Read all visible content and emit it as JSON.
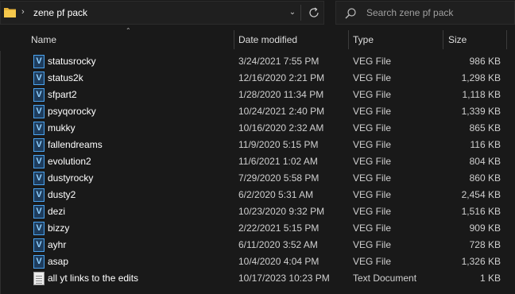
{
  "address_bar": {
    "path": "zene pf pack",
    "chevron": "›",
    "folder_icon": "folder-icon",
    "dropdown_icon": "chevron-down-icon",
    "refresh_icon": "refresh-icon"
  },
  "search": {
    "placeholder": "Search zene pf pack",
    "icon": "search-icon"
  },
  "columns": {
    "name": "Name",
    "date": "Date modified",
    "type": "Type",
    "size": "Size"
  },
  "files": [
    {
      "name": "statusrocky",
      "date": "3/24/2021 7:55 PM",
      "type": "VEG File",
      "size": "986 KB",
      "icon": "veg-file-icon"
    },
    {
      "name": "status2k",
      "date": "12/16/2020 2:21 PM",
      "type": "VEG File",
      "size": "1,298 KB",
      "icon": "veg-file-icon"
    },
    {
      "name": "sfpart2",
      "date": "1/28/2020 11:34 PM",
      "type": "VEG File",
      "size": "1,118 KB",
      "icon": "veg-file-icon"
    },
    {
      "name": "psyqorocky",
      "date": "10/24/2021 2:40 PM",
      "type": "VEG File",
      "size": "1,339 KB",
      "icon": "veg-file-icon"
    },
    {
      "name": "mukky",
      "date": "10/16/2020 2:32 AM",
      "type": "VEG File",
      "size": "865 KB",
      "icon": "veg-file-icon"
    },
    {
      "name": "fallendreams",
      "date": "11/9/2020 5:15 PM",
      "type": "VEG File",
      "size": "116 KB",
      "icon": "veg-file-icon"
    },
    {
      "name": "evolution2",
      "date": "11/6/2021 1:02 AM",
      "type": "VEG File",
      "size": "804 KB",
      "icon": "veg-file-icon"
    },
    {
      "name": "dustyrocky",
      "date": "7/29/2020 5:58 PM",
      "type": "VEG File",
      "size": "860 KB",
      "icon": "veg-file-icon"
    },
    {
      "name": "dusty2",
      "date": "6/2/2020 5:31 AM",
      "type": "VEG File",
      "size": "2,454 KB",
      "icon": "veg-file-icon"
    },
    {
      "name": "dezi",
      "date": "10/23/2020 9:32 PM",
      "type": "VEG File",
      "size": "1,516 KB",
      "icon": "veg-file-icon"
    },
    {
      "name": "bizzy",
      "date": "2/22/2021 5:15 PM",
      "type": "VEG File",
      "size": "909 KB",
      "icon": "veg-file-icon"
    },
    {
      "name": "ayhr",
      "date": "6/11/2020 3:52 AM",
      "type": "VEG File",
      "size": "728 KB",
      "icon": "veg-file-icon"
    },
    {
      "name": "asap",
      "date": "10/4/2020 4:04 PM",
      "type": "VEG File",
      "size": "1,326 KB",
      "icon": "veg-file-icon"
    },
    {
      "name": "all yt links to the edits",
      "date": "10/17/2023 10:23 PM",
      "type": "Text Document",
      "size": "1 KB",
      "icon": "text-file-icon"
    }
  ],
  "colors": {
    "background": "#191919",
    "veg_icon_blue": "#4aa3f0",
    "folder_yellow": "#f3c244"
  }
}
